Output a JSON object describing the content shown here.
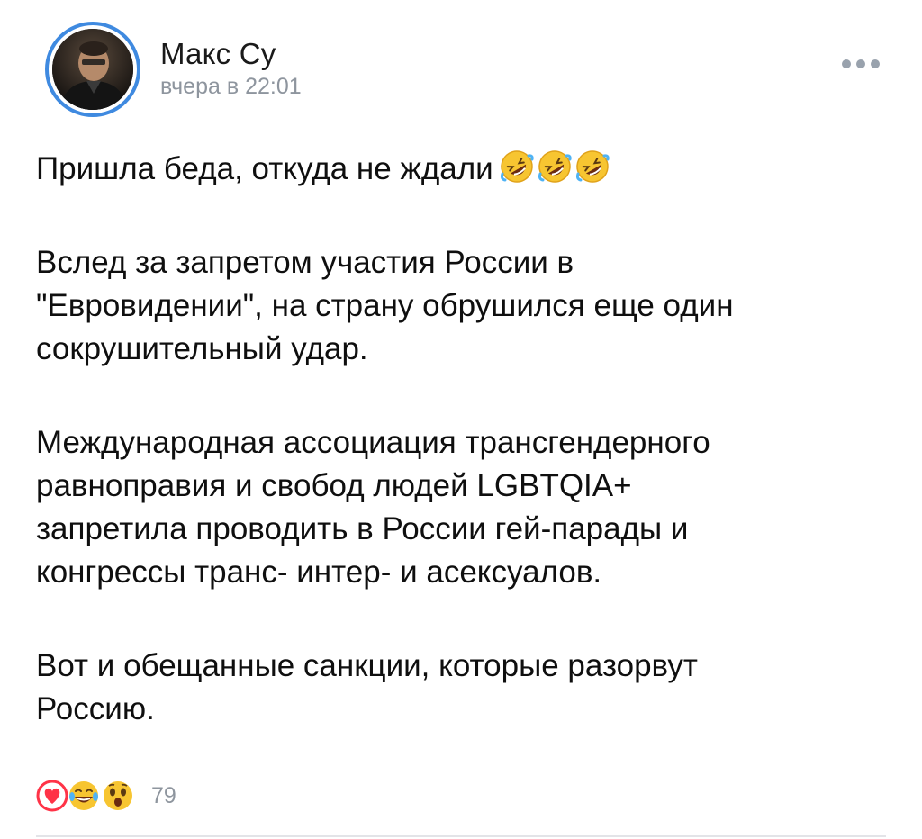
{
  "post": {
    "author": {
      "name": "Макс Су",
      "avatar_icon": "user-avatar-photo"
    },
    "date": "вчера в 22:01",
    "more_icon": "more-horizontal-icon",
    "accent_color": "#3f8ae0",
    "paragraphs": [
      {
        "lines": [
          "Пришла беда, откуда не ждали"
        ],
        "trailing_emoji": [
          "rolling-on-floor-laughing-emoji",
          "rolling-on-floor-laughing-emoji",
          "rolling-on-floor-laughing-emoji"
        ]
      },
      {
        "lines": [
          "Вслед за запретом участия России в",
          "\"Евровидении\", на страну обрушился еще один",
          "сокрушительный удар."
        ]
      },
      {
        "lines": [
          "Международная ассоциация трансгендерного",
          "равноправия и свобод людей LGBTQIA+",
          "запретила проводить в России гей-парады и",
          "конгрессы транс- интер- и асексуалов."
        ]
      },
      {
        "lines": [
          "Вот и обещанные санкции, которые разорвут",
          "Россию."
        ]
      }
    ],
    "reactions": {
      "icons": [
        "heart-reaction-icon",
        "laughing-reaction-icon",
        "surprised-reaction-icon"
      ],
      "count": "79"
    }
  }
}
